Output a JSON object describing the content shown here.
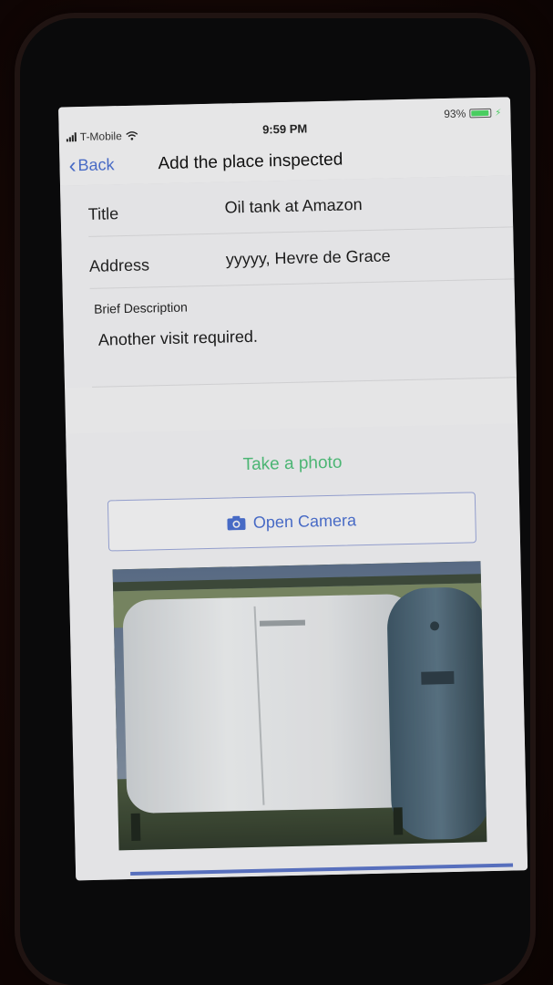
{
  "status_bar": {
    "carrier": "T-Mobile",
    "time": "9:59 PM",
    "battery_percent": "93%",
    "battery_level": 0.93
  },
  "nav": {
    "back_label": "Back",
    "title": "Add the place inspected"
  },
  "form": {
    "title_label": "Title",
    "title_value": "Oil tank at Amazon",
    "address_label": "Address",
    "address_value": "yyyyy, Hevre de Grace",
    "description_label": "Brief Description",
    "description_value": "Another visit required."
  },
  "photo": {
    "heading": "Take a photo",
    "open_camera_label": "Open Camera",
    "preview_icon": "oil-tank-photo"
  },
  "colors": {
    "accent_blue": "#4a6fd1",
    "accent_green": "#4fc07a",
    "battery_green": "#4cd964"
  }
}
